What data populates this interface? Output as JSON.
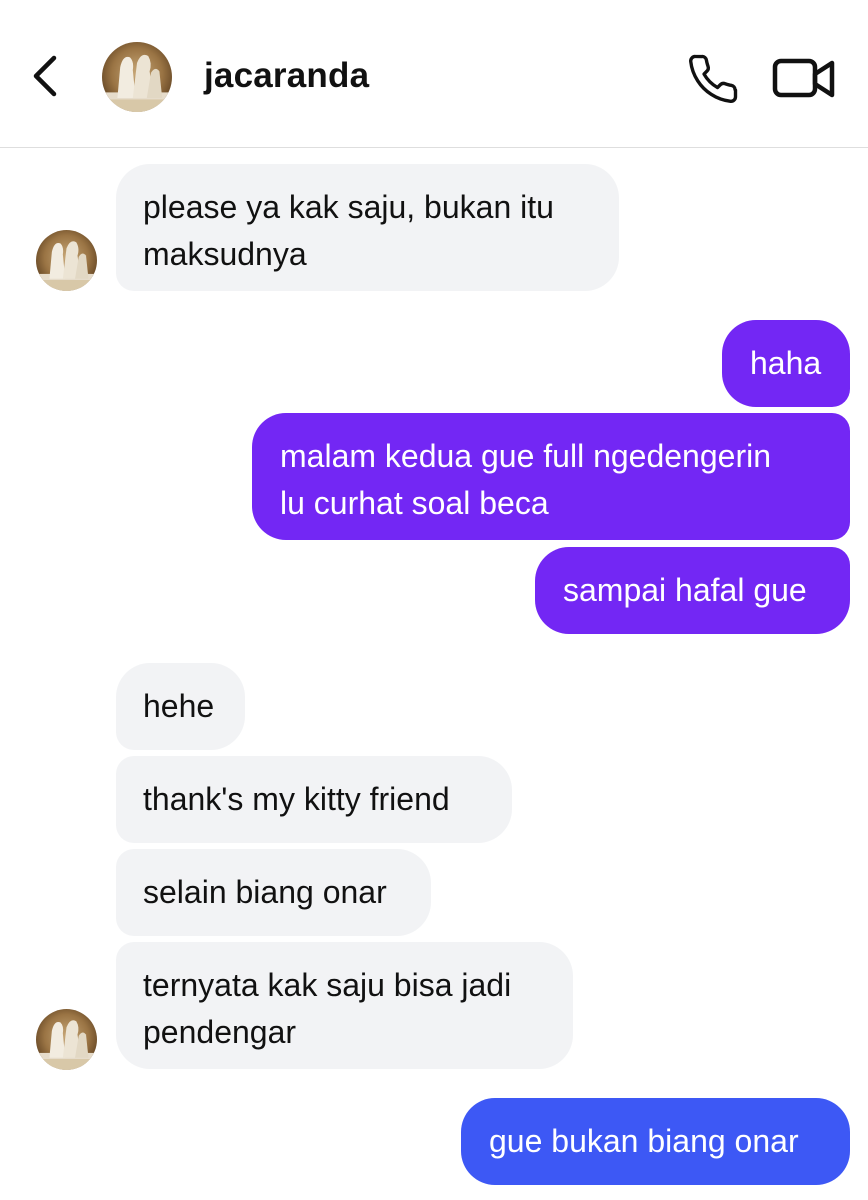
{
  "header": {
    "contact_name": "jacaranda",
    "back_icon": "chevron-left-icon",
    "call_icon": "phone-icon",
    "video_icon": "video-camera-icon",
    "avatar": "contact-avatar"
  },
  "colors": {
    "incoming_bubble": "#f2f3f5",
    "outgoing_bubble_purple": "#7327f4",
    "outgoing_bubble_blue": "#3d58f5",
    "text_dark": "#111111",
    "text_light": "#ffffff"
  },
  "messages": [
    {
      "direction": "incoming",
      "lines": [
        "please ya kak saju, bukan itu",
        "maksudnya"
      ]
    },
    {
      "direction": "outgoing",
      "lines": [
        "haha"
      ]
    },
    {
      "direction": "outgoing",
      "lines": [
        "malam kedua gue full ngedengerin",
        "lu curhat soal beca"
      ]
    },
    {
      "direction": "outgoing",
      "lines": [
        "sampai hafal gue"
      ]
    },
    {
      "direction": "incoming",
      "lines": [
        "hehe"
      ]
    },
    {
      "direction": "incoming",
      "lines": [
        "thank's my kitty friend"
      ]
    },
    {
      "direction": "incoming",
      "lines": [
        "selain biang onar"
      ]
    },
    {
      "direction": "incoming",
      "lines": [
        "ternyata kak saju bisa jadi",
        "pendengar"
      ]
    },
    {
      "direction": "outgoing",
      "lines": [
        "gue bukan biang onar"
      ]
    }
  ]
}
